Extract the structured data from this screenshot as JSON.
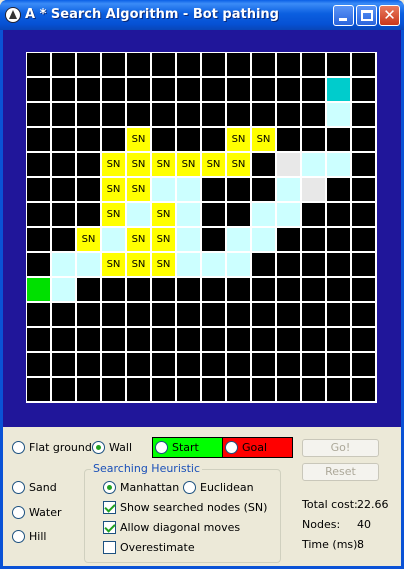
{
  "window": {
    "title": "A * Search Algorithm - Bot pathing",
    "close_glyph": "✕"
  },
  "grid": {
    "rows": 14,
    "cols": 14,
    "cell_label": "SN",
    "cells": [
      {
        "row": 1,
        "col": 12,
        "type": "goal"
      },
      {
        "row": 2,
        "col": 12,
        "type": "path"
      },
      {
        "row": 3,
        "col": 4,
        "type": "sn"
      },
      {
        "row": 3,
        "col": 8,
        "type": "sn"
      },
      {
        "row": 3,
        "col": 9,
        "type": "sn"
      },
      {
        "row": 4,
        "col": 3,
        "type": "sn"
      },
      {
        "row": 4,
        "col": 4,
        "type": "sn"
      },
      {
        "row": 4,
        "col": 5,
        "type": "sn"
      },
      {
        "row": 4,
        "col": 6,
        "type": "sn"
      },
      {
        "row": 4,
        "col": 7,
        "type": "sn"
      },
      {
        "row": 4,
        "col": 8,
        "type": "sn"
      },
      {
        "row": 4,
        "col": 10,
        "type": "flat"
      },
      {
        "row": 4,
        "col": 11,
        "type": "path"
      },
      {
        "row": 4,
        "col": 12,
        "type": "path"
      },
      {
        "row": 5,
        "col": 3,
        "type": "sn"
      },
      {
        "row": 5,
        "col": 4,
        "type": "sn"
      },
      {
        "row": 5,
        "col": 5,
        "type": "path"
      },
      {
        "row": 5,
        "col": 6,
        "type": "path"
      },
      {
        "row": 5,
        "col": 10,
        "type": "path"
      },
      {
        "row": 5,
        "col": 11,
        "type": "flat"
      },
      {
        "row": 6,
        "col": 3,
        "type": "sn"
      },
      {
        "row": 6,
        "col": 4,
        "type": "path"
      },
      {
        "row": 6,
        "col": 5,
        "type": "sn"
      },
      {
        "row": 6,
        "col": 6,
        "type": "path"
      },
      {
        "row": 6,
        "col": 9,
        "type": "path"
      },
      {
        "row": 6,
        "col": 10,
        "type": "path"
      },
      {
        "row": 7,
        "col": 2,
        "type": "sn"
      },
      {
        "row": 7,
        "col": 3,
        "type": "path"
      },
      {
        "row": 7,
        "col": 4,
        "type": "sn"
      },
      {
        "row": 7,
        "col": 5,
        "type": "sn"
      },
      {
        "row": 7,
        "col": 6,
        "type": "path"
      },
      {
        "row": 7,
        "col": 8,
        "type": "path"
      },
      {
        "row": 7,
        "col": 9,
        "type": "path"
      },
      {
        "row": 8,
        "col": 1,
        "type": "path"
      },
      {
        "row": 8,
        "col": 2,
        "type": "path"
      },
      {
        "row": 8,
        "col": 3,
        "type": "sn"
      },
      {
        "row": 8,
        "col": 4,
        "type": "sn"
      },
      {
        "row": 8,
        "col": 5,
        "type": "sn"
      },
      {
        "row": 8,
        "col": 6,
        "type": "path"
      },
      {
        "row": 8,
        "col": 7,
        "type": "path"
      },
      {
        "row": 8,
        "col": 8,
        "type": "path"
      },
      {
        "row": 9,
        "col": 0,
        "type": "start"
      },
      {
        "row": 9,
        "col": 1,
        "type": "path"
      }
    ]
  },
  "tile_types": {
    "flat_ground": "Flat ground",
    "wall": "Wall",
    "sand": "Sand",
    "water": "Water",
    "hill": "Hill",
    "selected": "wall"
  },
  "endpoints": {
    "start_label": "Start",
    "goal_label": "Goal",
    "start_color": "#00ff00",
    "goal_color": "#ff0000"
  },
  "heuristic": {
    "legend": "Searching Heuristic",
    "manhattan": "Manhattan",
    "euclidean": "Euclidean",
    "selected": "manhattan",
    "show_searched_label": "Show searched nodes (SN)",
    "show_searched": true,
    "diagonal_label": "Allow diagonal moves",
    "diagonal": true,
    "overestimate_label": "Overestimate",
    "overestimate": false
  },
  "buttons": {
    "go": "Go!",
    "reset": "Reset"
  },
  "stats": {
    "total_cost_label": "Total cost:",
    "total_cost": "22.66",
    "nodes_label": "Nodes:",
    "nodes": "40",
    "time_label": "Time (ms):",
    "time": "8"
  },
  "colors": {
    "board_bg": "#20169a",
    "wall": "#000000",
    "path": "#ccffff",
    "searched": "#ffff00",
    "start": "#00e000",
    "goal": "#00cccc",
    "flat": "#e8e8e8"
  }
}
